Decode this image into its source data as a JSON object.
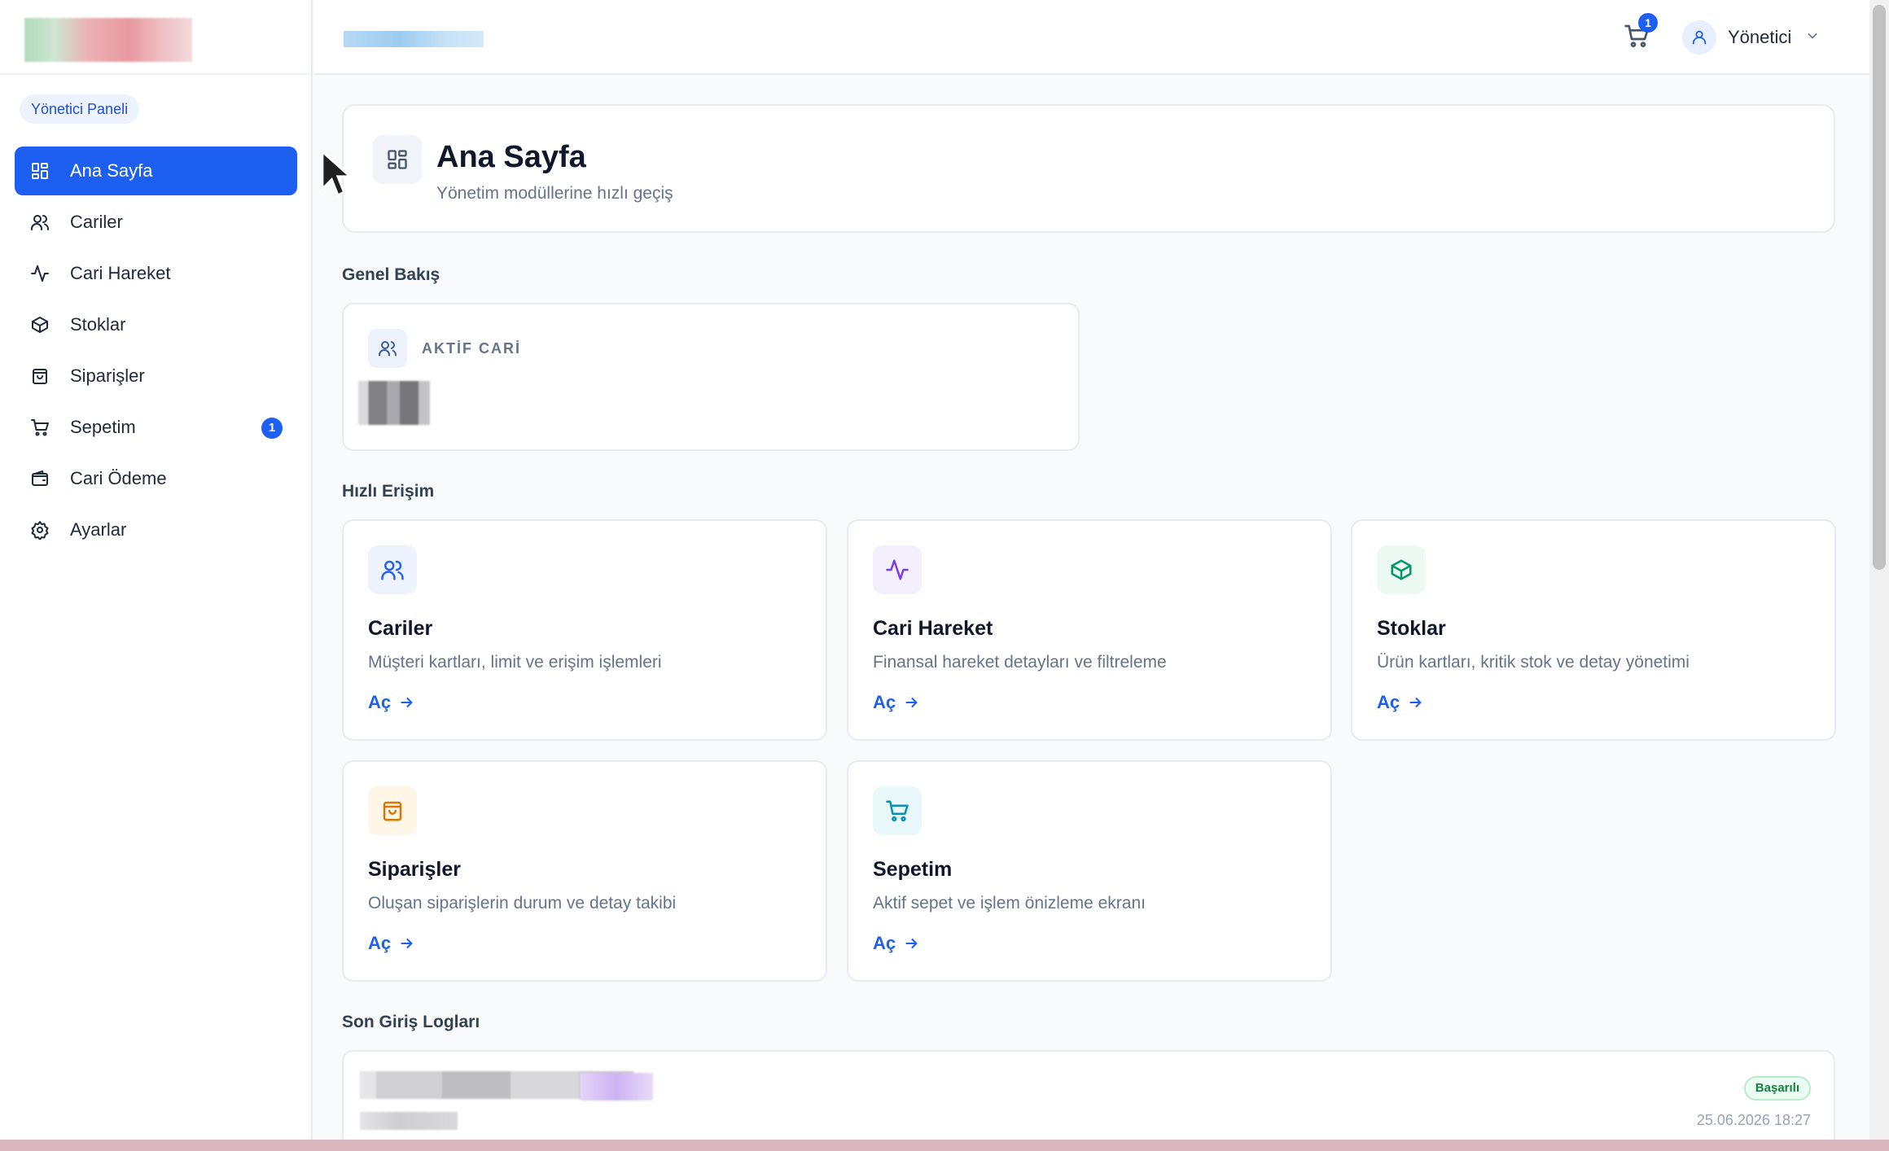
{
  "sidebar": {
    "role_label": "Yönetici Paneli",
    "items": [
      {
        "label": "Ana Sayfa",
        "icon": "grid-icon",
        "active": true
      },
      {
        "label": "Cariler",
        "icon": "users-icon"
      },
      {
        "label": "Cari Hareket",
        "icon": "activity-icon"
      },
      {
        "label": "Stoklar",
        "icon": "box-icon"
      },
      {
        "label": "Siparişler",
        "icon": "bag-icon"
      },
      {
        "label": "Sepetim",
        "icon": "cart-icon",
        "badge": "1"
      },
      {
        "label": "Cari Ödeme",
        "icon": "wallet-icon"
      },
      {
        "label": "Ayarlar",
        "icon": "gear-icon"
      }
    ]
  },
  "topbar": {
    "cart_count": "1",
    "user_name": "Yönetici"
  },
  "header": {
    "title": "Ana Sayfa",
    "subtitle": "Yönetim modüllerine hızlı geçiş"
  },
  "overview": {
    "section_title": "Genel Bakış",
    "stat_label": "AKTİF CARİ"
  },
  "quick_access": {
    "section_title": "Hızlı Erişim",
    "cards": [
      {
        "title": "Cariler",
        "desc": "Müşteri kartları, limit ve erişim işlemleri",
        "link": "Aç",
        "icon": "users-icon",
        "color": "#2563eb",
        "bg": "#eef3fe"
      },
      {
        "title": "Cari Hareket",
        "desc": "Finansal hareket detayları ve filtreleme",
        "link": "Aç",
        "icon": "activity-icon",
        "color": "#7c3aed",
        "bg": "#f4effd"
      },
      {
        "title": "Stoklar",
        "desc": "Ürün kartları, kritik stok ve detay yönetimi",
        "link": "Aç",
        "icon": "box-icon",
        "color": "#059669",
        "bg": "#ecfaf3"
      },
      {
        "title": "Siparişler",
        "desc": "Oluşan siparişlerin durum ve detay takibi",
        "link": "Aç",
        "icon": "bag-icon",
        "color": "#d97706",
        "bg": "#fef6e7"
      },
      {
        "title": "Sepetim",
        "desc": "Aktif sepet ve işlem önizleme ekranı",
        "link": "Aç",
        "icon": "cart-icon",
        "color": "#0891b2",
        "bg": "#e9f8fb"
      }
    ]
  },
  "logs": {
    "section_title": "Son Giriş Logları",
    "entries": [
      {
        "status": "Başarılı",
        "time": "25.06.2026 18:27"
      }
    ]
  }
}
